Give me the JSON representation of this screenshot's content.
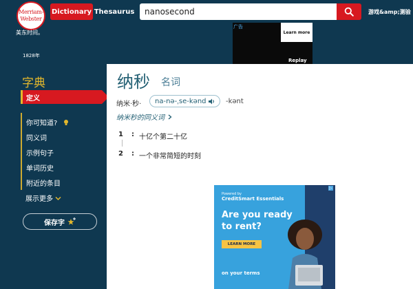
{
  "header": {
    "logo_line1": "Merriam-",
    "logo_line2": "Webster",
    "logo_sub": "美东时间。",
    "established": "1828年",
    "tabs": {
      "dictionary": "Dictionary",
      "thesaurus": "Thesaurus"
    },
    "search": {
      "value": "nanosecond"
    },
    "games": "游戏&amp;测验"
  },
  "top_ad": {
    "tag": "广告",
    "learn_more": "Learn more",
    "replay": "Replay"
  },
  "sidebar": {
    "title": "字典",
    "active": "定义",
    "items": [
      "你可知道?",
      "同义词",
      "示例句子",
      "单词历史",
      "附近的条目"
    ],
    "more": "展示更多",
    "save": "保存字"
  },
  "entry": {
    "headword": "纳秒",
    "pos": "名词",
    "syllables": "纳米·秒·",
    "pron1": "na-nə-ˌse-kənd",
    "pron2": "-kənt",
    "synonyms_link": "纳米秒的同义词",
    "definitions": [
      {
        "num": "1",
        "text": "十亿个第二十亿"
      },
      {
        "num": "2",
        "text": "一个非常简短的时刻"
      }
    ]
  },
  "bottom_ad": {
    "brand_small": "Powered by",
    "brand": "CreditSmart Essentials",
    "headline": "Are you ready to rent?",
    "button": "LEARN MORE",
    "footer": "on your terms",
    "info": "▷"
  },
  "colors": {
    "navy": "#0f3850",
    "red": "#d71920",
    "gold": "#e4b82c",
    "link": "#225f73"
  }
}
